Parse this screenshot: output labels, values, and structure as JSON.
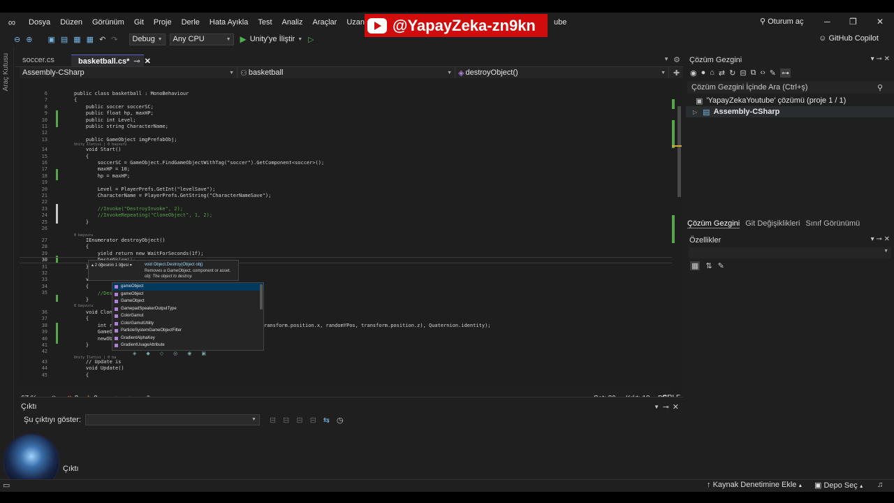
{
  "youtube_banner": {
    "handle": "@YapayZeka-zn9kn",
    "hidden_menu": "ube"
  },
  "menu": [
    "Dosya",
    "Düzen",
    "Görünüm",
    "Git",
    "Proje",
    "Derle",
    "Hata Ayıkla",
    "Test",
    "Analiz",
    "Araçlar",
    "Uzantılar"
  ],
  "title_bar": {
    "sign_in": "Oturum aç"
  },
  "toolbar": {
    "config": "Debug",
    "platform": "Any CPU",
    "run": "Unity'ye İliştir",
    "copilot": "GitHub Copilot"
  },
  "left_strip": {
    "label": "Araç Kutusu"
  },
  "editor": {
    "tabs": [
      {
        "label": "soccer.cs"
      },
      {
        "label": "basketball.cs*"
      }
    ],
    "nav": {
      "project": "Assembly-CSharp",
      "class": "basketball",
      "member": "destroyObject()"
    },
    "lines": [
      {
        "n": "6",
        "t": "public class basketball : MonoBehaviour"
      },
      {
        "n": "7",
        "t": "{"
      },
      {
        "n": "8",
        "t": "    public soccer soccerSC;"
      },
      {
        "n": "9",
        "t": "    public float hp, maxHP;"
      },
      {
        "n": "10",
        "t": "    public int Level;"
      },
      {
        "n": "11",
        "t": "    public string CharacterName;"
      },
      {
        "n": "12",
        "t": ""
      },
      {
        "n": "13",
        "t": "    public GameObject imgPrefabObj;"
      },
      {
        "n": "14",
        "t": "    void Start()"
      },
      {
        "n": "15",
        "t": "    {"
      },
      {
        "n": "16",
        "t": "        soccerSC = GameObject.FindGameObjectWithTag(\"soccer\").GetComponent<soccer>();"
      },
      {
        "n": "17",
        "t": "        maxHP = 10;"
      },
      {
        "n": "18",
        "t": "        hp = maxHP;"
      },
      {
        "n": "19",
        "t": ""
      },
      {
        "n": "20",
        "t": "        Level = PlayerPrefs.GetInt(\"levelSave\");"
      },
      {
        "n": "21",
        "t": "        CharacterName = PlayerPrefs.GetString(\"CharacterNameSave\");"
      },
      {
        "n": "22",
        "t": ""
      },
      {
        "n": "23",
        "t": "        //Invoke(\"DestroyInvoke\", 2);"
      },
      {
        "n": "24",
        "t": "        //InvokeRepeating(\"CloneObject\", 1, 2);"
      },
      {
        "n": "25",
        "t": "    }"
      },
      {
        "n": "26",
        "t": ""
      },
      {
        "n": "27",
        "t": "    IEnumerator destroyObject()"
      },
      {
        "n": "28",
        "t": "    {"
      },
      {
        "n": "29",
        "t": "        yield return new WaitForSeconds(1f);"
      },
      {
        "n": "30",
        "t": "        Destroy(ga"
      },
      {
        "n": "31",
        "t": "    }"
      },
      {
        "n": "32",
        "t": "    void"
      },
      {
        "n": "33",
        "t": "    {"
      },
      {
        "n": "34",
        "t": "        //Destro"
      },
      {
        "n": "35",
        "t": "    }"
      },
      {
        "n": "36",
        "t": "    void Clone0"
      },
      {
        "n": "37",
        "t": "    {"
      },
      {
        "n": "38",
        "t": "        int rand"
      },
      {
        "n": "39",
        "t": "        GameObje"
      },
      {
        "n": "40",
        "t": "        newObj.t"
      },
      {
        "n": "41",
        "t": "    }"
      },
      {
        "n": "42",
        "t": ""
      },
      {
        "n": "43",
        "t": "    // Update is"
      },
      {
        "n": "44",
        "t": "    void Update()"
      },
      {
        "n": "45",
        "t": "    {"
      },
      {
        "n": "46",
        "t": "        float horInput = Input.GetAxisRaw(\"Horizontal\");"
      }
    ],
    "line39_tail": "ransform.position.x, randomYPos, transform.position.z), Quaternion.identity);",
    "ghost_text": "meObject);",
    "hints": {
      "start": "Unity İletisi | 0 başvuru",
      "refs": "0 başvuru",
      "update": "Unity İletisi | 0 ba"
    }
  },
  "quick_info": {
    "count": "2 öğesinin 1 öğesi",
    "signature": "void Object.Destroy(Object obj)",
    "desc": "Removes a GameObject, component or asset.",
    "param": "obj: The object to destroy."
  },
  "completion": [
    "gameObject",
    "gameObject",
    "GameObject",
    "GamepadSpeakerOutputType",
    "ColorGamut",
    "ColorGamutUtility",
    "ParticleSystemGameObjectFilter",
    "GradientAlphaKey",
    "GradientUsageAttribute"
  ],
  "editor_status": {
    "zoom": "67 %",
    "errors": "2",
    "warnings": "0",
    "line": "Sat: 30",
    "col": "Krkt: 18",
    "spc": "BŞL",
    "eol": "CRLF"
  },
  "output": {
    "title": "Çıktı",
    "show_label": "Şu çıktıyı göster:",
    "tab": "Çıktı"
  },
  "solution": {
    "title": "Çözüm Gezgini",
    "search": "Çözüm Gezgini İçinde Ara (Ctrl+ş)",
    "root": "'YapayZekaYoutube' çözümü (proje 1 / 1)",
    "project": "Assembly-CSharp",
    "tabs": [
      "Çözüm Gezgini",
      "Git Değişiklikleri",
      "Sınıf Görünümü"
    ]
  },
  "properties": {
    "title": "Özellikler"
  },
  "statusbar": {
    "source_control": "Kaynak Denetimine Ekle",
    "repo": "Depo Seç"
  }
}
